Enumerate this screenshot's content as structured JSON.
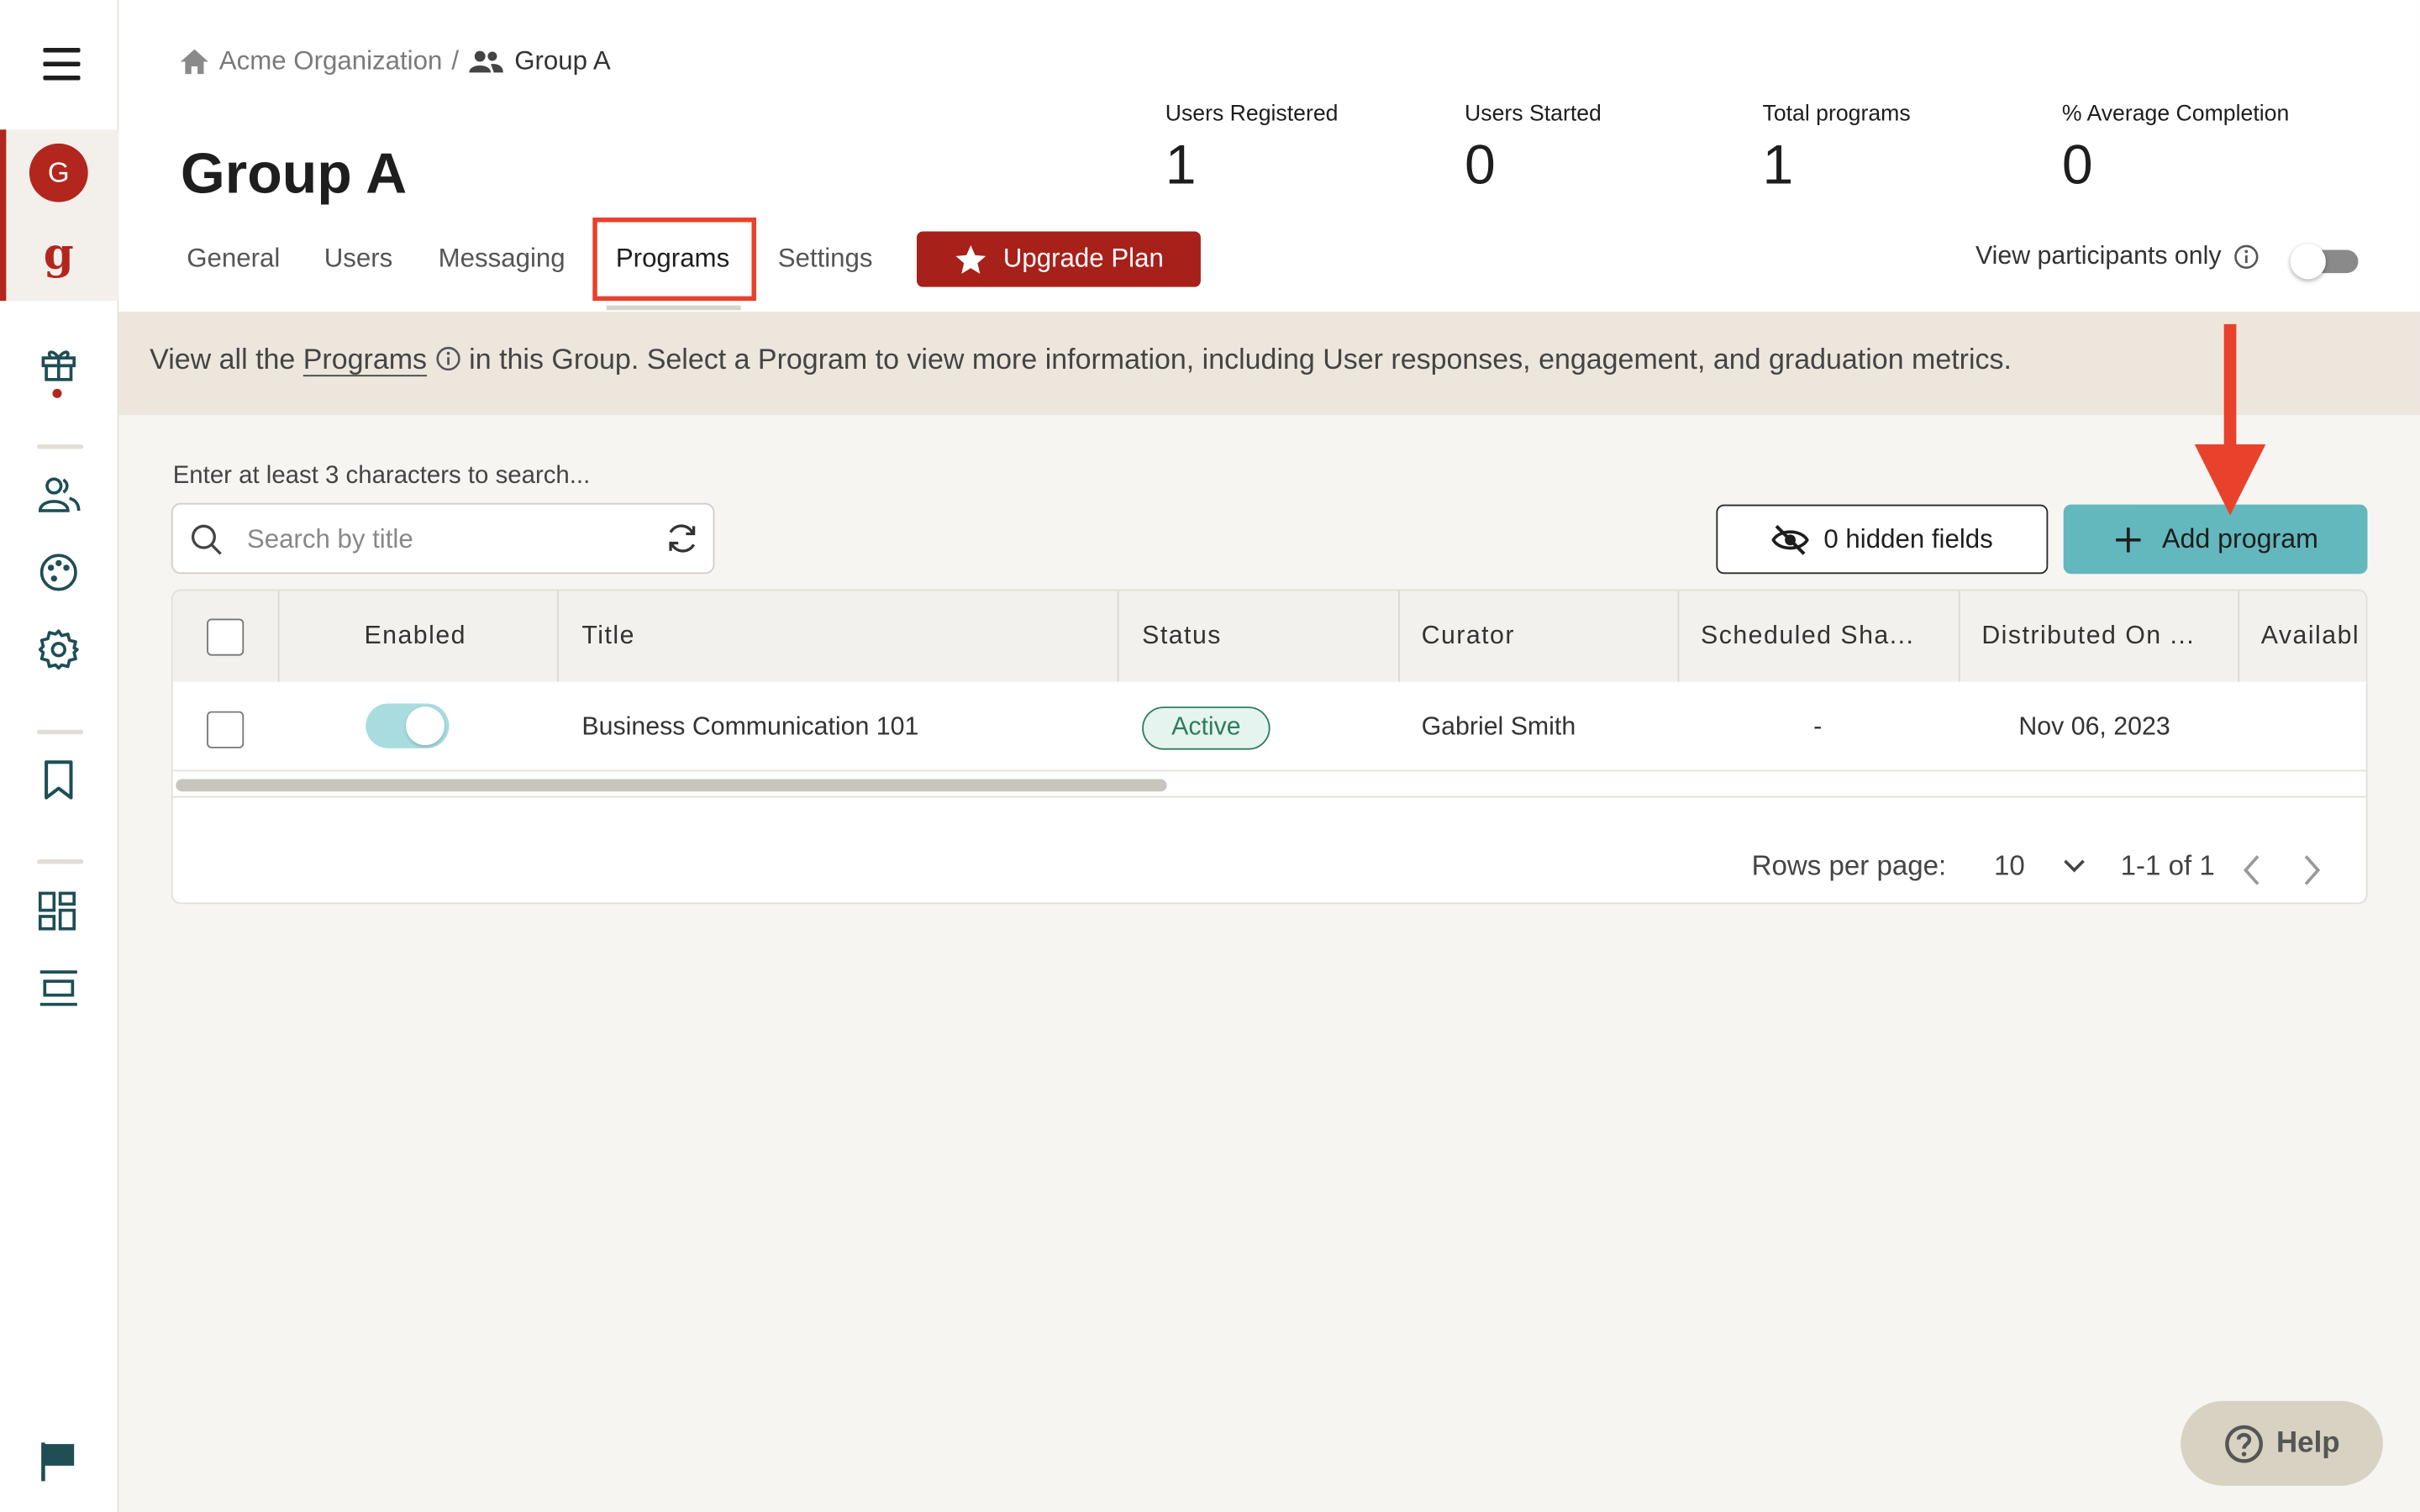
{
  "breadcrumb": {
    "org": "Acme Organization",
    "separator": "/",
    "current": "Group A"
  },
  "sidebar": {
    "avatar_letter": "G",
    "brand_letter": "g"
  },
  "page": {
    "title": "Group A"
  },
  "stats": [
    {
      "label": "Users Registered",
      "value": "1"
    },
    {
      "label": "Users Started",
      "value": "0"
    },
    {
      "label": "Total programs",
      "value": "1"
    },
    {
      "label": "% Average Completion",
      "value": "0"
    }
  ],
  "tabs": [
    {
      "label": "General"
    },
    {
      "label": "Users"
    },
    {
      "label": "Messaging"
    },
    {
      "label": "Programs",
      "selected": true
    },
    {
      "label": "Settings"
    }
  ],
  "upgrade": {
    "label": "Upgrade Plan"
  },
  "view_only": {
    "label": "View participants only",
    "enabled": false
  },
  "banner": {
    "before": "View all the ",
    "link": "Programs",
    "after": " in this Group. Select a Program to view more information, including User responses, engagement, and graduation metrics."
  },
  "search": {
    "hint": "Enter at least 3 characters to search...",
    "placeholder": "Search by title",
    "value": ""
  },
  "buttons": {
    "hidden_fields": "0 hidden fields",
    "add_program": "Add program"
  },
  "table": {
    "columns": [
      "Enabled",
      "Title",
      "Status",
      "Curator",
      "Scheduled Sha...",
      "Distributed On ...",
      "Availabl"
    ],
    "rows": [
      {
        "enabled": true,
        "title": "Business Communication 101",
        "status": "Active",
        "curator": "Gabriel Smith",
        "scheduled": "-",
        "distributed": "Nov 06, 2023",
        "available": ""
      }
    ],
    "scroll_position": 0
  },
  "pagination": {
    "rows_label": "Rows per page:",
    "rows_value": "10",
    "range": "1-1 of 1"
  },
  "help": {
    "label": "Help"
  },
  "colors": {
    "accent_red": "#a8201a",
    "teal": "#62b8bd",
    "annotation_red": "#e8412c",
    "active_green": "#2e7d5e"
  }
}
